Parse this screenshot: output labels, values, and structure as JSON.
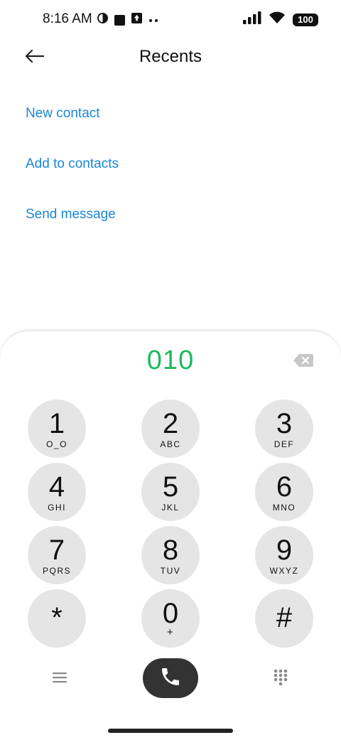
{
  "status_bar": {
    "time": "8:16 AM",
    "battery": "100",
    "icons_left": [
      "moon-half-icon",
      "square-notification-icon",
      "upload-notification-icon",
      "more-dots-icon"
    ],
    "icons_right": [
      "signal-icon",
      "wifi-icon",
      "battery-icon"
    ]
  },
  "header": {
    "title": "Recents",
    "back_icon": "back-arrow-icon"
  },
  "actions": [
    {
      "label": "New contact"
    },
    {
      "label": "Add to contacts"
    },
    {
      "label": "Send message"
    }
  ],
  "colors": {
    "link": "#1a86d9",
    "dialed_number": "#1fb85c",
    "key_bg": "#e5e5e5",
    "call_bg": "#333333"
  },
  "dialer": {
    "number": "010",
    "backspace_icon": "backspace-icon",
    "keys": [
      {
        "digit": "1",
        "letters": "O_O"
      },
      {
        "digit": "2",
        "letters": "ABC"
      },
      {
        "digit": "3",
        "letters": "DEF"
      },
      {
        "digit": "4",
        "letters": "GHI"
      },
      {
        "digit": "5",
        "letters": "JKL"
      },
      {
        "digit": "6",
        "letters": "MNO"
      },
      {
        "digit": "7",
        "letters": "PQRS"
      },
      {
        "digit": "8",
        "letters": "TUV"
      },
      {
        "digit": "9",
        "letters": "WXYZ"
      },
      {
        "digit": "*",
        "letters": ""
      },
      {
        "digit": "0",
        "letters": "+"
      },
      {
        "digit": "#",
        "letters": ""
      }
    ],
    "bottom_bar": {
      "menu_icon": "menu-icon",
      "call_icon": "phone-icon",
      "keypad_icon": "dialpad-icon"
    }
  }
}
